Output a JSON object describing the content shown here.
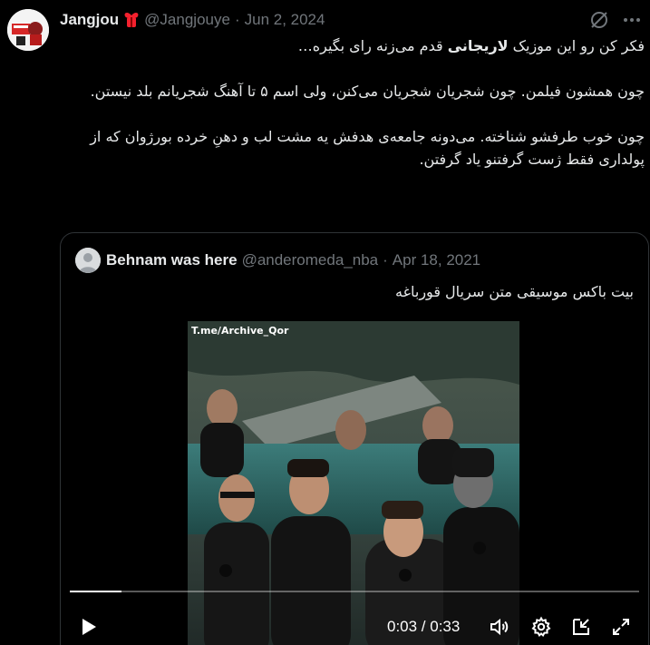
{
  "tweet": {
    "display_name": "Jangjou",
    "badge_icon": "red-gift-bow-icon",
    "handle": "@Jangjouye",
    "separator": "·",
    "date": "Jun 2, 2024",
    "paragraphs": [
      {
        "before": "فکر کن رو این موزیک ",
        "bold": "لاریجانی",
        "after": " قدم می‌زنه رای بگیره…"
      },
      {
        "text": "چون همشون فیلمن. چون شجریان شجریان می‌کنن، ولی اسم ۵ تا آهنگ شجریانم بلد نیستن."
      },
      {
        "text": "چون خوب طرفشو شناخته. می‌دونه جامعه‌ی هدفش یه مشت لب و دهنِ خرده بورژوان که از پولداری فقط ژست گرفتنو یاد گرفتن."
      }
    ]
  },
  "quoted": {
    "display_name": "Behnam was here",
    "handle": "@anderomeda_nba",
    "separator": "·",
    "date": "Apr 18, 2021",
    "text": "بیت باکس موسیقی متن سریال قورباغه"
  },
  "video": {
    "watermark": "T.me/Archive_Qor",
    "time_display": "0:03 / 0:33",
    "progress": 0.09
  },
  "colors": {
    "background": "#000000",
    "text_primary": "#e7e9ea",
    "text_secondary": "#71767b",
    "border": "#2f3336"
  }
}
